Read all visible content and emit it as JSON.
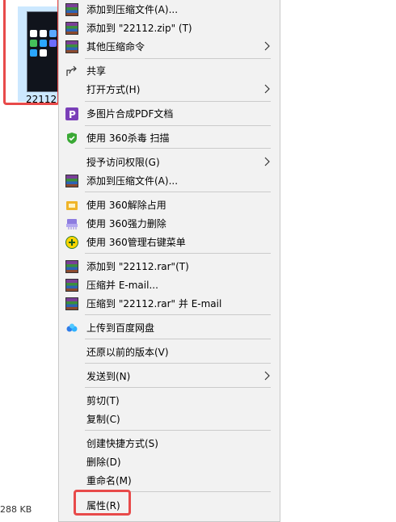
{
  "file": {
    "name": "22112.",
    "size": "288 KB"
  },
  "menu": {
    "items": [
      {
        "label": "添加到压缩文件(A)...",
        "icon": "winrar-icon"
      },
      {
        "label": "添加到 \"22112.zip\" (T)",
        "icon": "winrar-icon"
      },
      {
        "label": "其他压缩命令",
        "icon": "winrar-icon",
        "submenu": true
      },
      {
        "label": "共享",
        "icon": "share-icon"
      },
      {
        "label": "打开方式(H)",
        "submenu": true
      },
      {
        "label": "多图片合成PDF文档",
        "icon": "pdf-icon"
      },
      {
        "label": "使用 360杀毒 扫描",
        "icon": "shield-360-icon"
      },
      {
        "label": "授予访问权限(G)",
        "submenu": true
      },
      {
        "label": "添加到压缩文件(A)...",
        "icon": "winrar-icon"
      },
      {
        "label": "使用 360解除占用",
        "icon": "unlock-360-icon"
      },
      {
        "label": "使用 360强力删除",
        "icon": "shred-360-icon"
      },
      {
        "label": "使用 360管理右键菜单",
        "icon": "manage-360-icon"
      },
      {
        "label": "添加到 \"22112.rar\"(T)",
        "icon": "winrar-icon"
      },
      {
        "label": "压缩并 E-mail...",
        "icon": "winrar-icon"
      },
      {
        "label": "压缩到 \"22112.rar\" 并 E-mail",
        "icon": "winrar-icon"
      },
      {
        "label": "上传到百度网盘",
        "icon": "baidu-cloud-icon"
      },
      {
        "label": "还原以前的版本(V)"
      },
      {
        "label": "发送到(N)",
        "submenu": true
      },
      {
        "label": "剪切(T)"
      },
      {
        "label": "复制(C)"
      },
      {
        "label": "创建快捷方式(S)"
      },
      {
        "label": "删除(D)"
      },
      {
        "label": "重命名(M)"
      },
      {
        "label": "属性(R)"
      }
    ]
  },
  "colors": {
    "highlight": "#e84a4a",
    "selection": "#cce8ff",
    "menu_bg": "#f2f2f2"
  }
}
